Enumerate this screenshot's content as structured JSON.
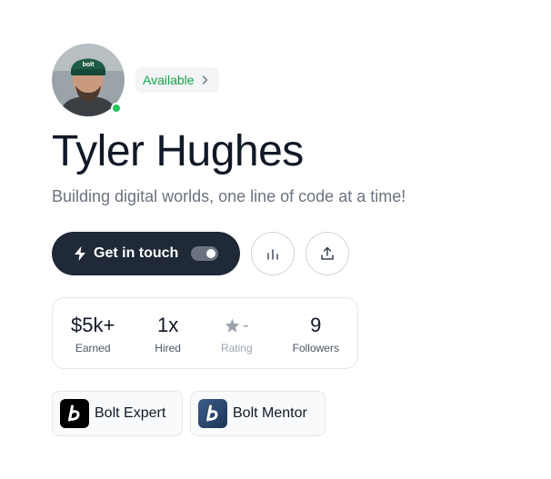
{
  "profile": {
    "name": "Tyler Hughes",
    "tagline": "Building digital worlds, one line of code at a time!",
    "avatar": {
      "beanie_text": "bolt"
    },
    "status": {
      "label": "Available",
      "color": "#16a34a"
    }
  },
  "actions": {
    "contact_label": "Get in touch",
    "contact_toggle_on": true,
    "stats_icon": "bar-chart-icon",
    "share_icon": "share-icon"
  },
  "stats": [
    {
      "value": "$5k+",
      "label": "Earned"
    },
    {
      "value": "1x",
      "label": "Hired"
    },
    {
      "value": "-",
      "label": "Rating",
      "icon": "star-icon"
    },
    {
      "value": "9",
      "label": "Followers"
    }
  ],
  "badges": [
    {
      "label": "Bolt Expert",
      "icon": "bolt-logo-icon"
    },
    {
      "label": "Bolt Mentor",
      "icon": "bolt-logo-icon"
    }
  ],
  "colors": {
    "primary": "#1f2937",
    "accent_green": "#22c55e",
    "muted": "#6b7280"
  }
}
